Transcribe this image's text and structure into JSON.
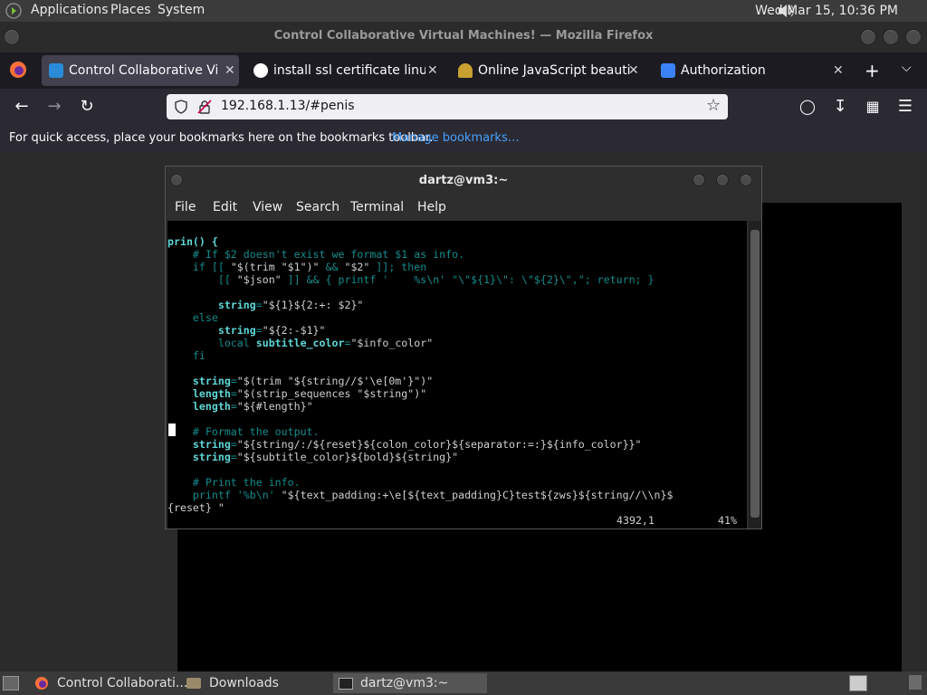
{
  "top_panel": {
    "menus": [
      "Applications",
      "Places",
      "System"
    ],
    "clock": "Wed Mar 15, 10:36 PM"
  },
  "firefox": {
    "title": "Control Collaborative Virtual Machines! — Mozilla Firefox",
    "tabs": [
      {
        "label": "Control Collaborative Virtual",
        "icon": "monitor-icon",
        "active": true
      },
      {
        "label": "install ssl certificate linux - G",
        "icon": "google-icon"
      },
      {
        "label": "Online JavaScript beautifier",
        "icon": "beautifier-icon"
      },
      {
        "label": "Authorization",
        "icon": "auth-icon"
      }
    ],
    "close_glyph": "✕",
    "url": "192.168.1.13/#penis",
    "bookmarks_prompt": "For quick access, place your bookmarks here on the bookmarks toolbar.",
    "bookmarks_link": "Manage bookmarks…"
  },
  "terminal": {
    "title": "dartz@vm3:~",
    "menu": [
      "File",
      "Edit",
      "View",
      "Search",
      "Terminal",
      "Help"
    ],
    "status_pos": "4392,1",
    "status_pct": "41%"
  },
  "taskbar": {
    "items": [
      "Control Collaborati...",
      "Downloads",
      "dartz@vm3:~"
    ]
  }
}
